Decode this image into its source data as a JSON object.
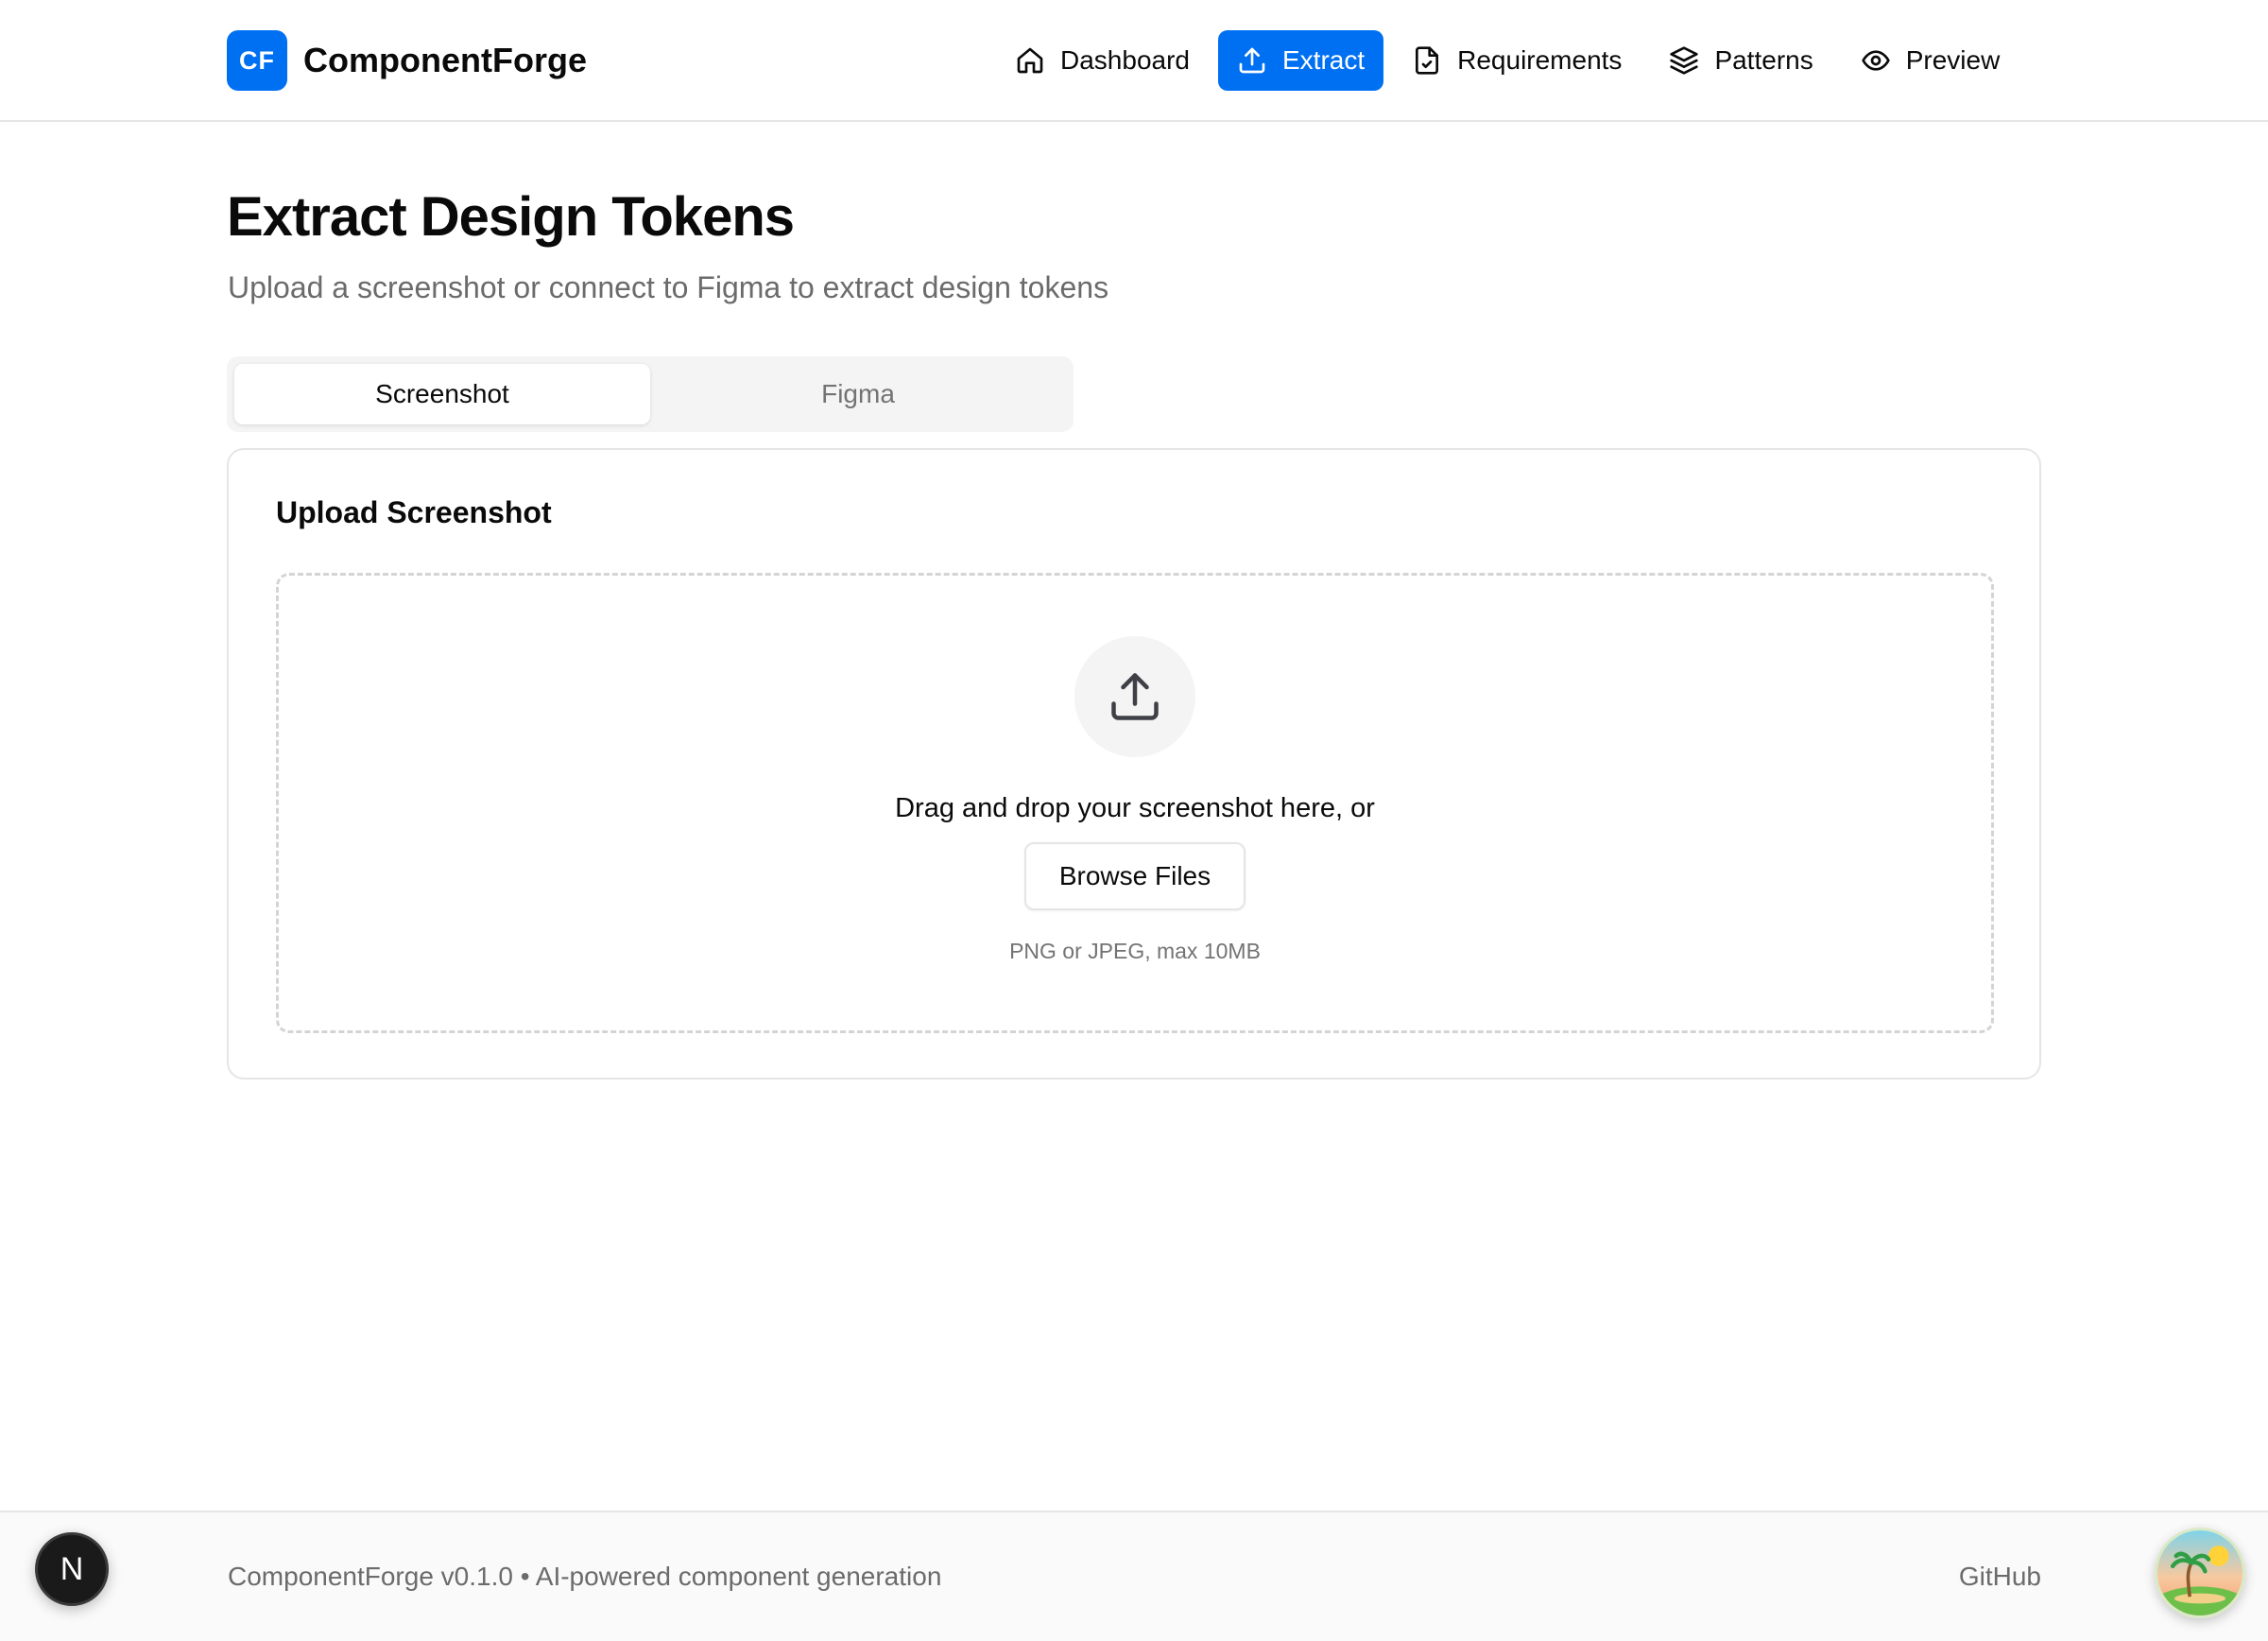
{
  "brand": {
    "logo_text": "CF",
    "name": "ComponentForge",
    "accent_color": "#0070f3"
  },
  "nav": {
    "items": [
      {
        "label": "Dashboard",
        "icon": "home-icon",
        "active": false
      },
      {
        "label": "Extract",
        "icon": "upload-icon",
        "active": true
      },
      {
        "label": "Requirements",
        "icon": "file-check-icon",
        "active": false
      },
      {
        "label": "Patterns",
        "icon": "layers-icon",
        "active": false
      },
      {
        "label": "Preview",
        "icon": "eye-icon",
        "active": false
      }
    ]
  },
  "page": {
    "title": "Extract Design Tokens",
    "subtitle": "Upload a screenshot or connect to Figma to extract design tokens"
  },
  "tabs": [
    {
      "label": "Screenshot",
      "active": true
    },
    {
      "label": "Figma",
      "active": false
    }
  ],
  "upload": {
    "card_title": "Upload Screenshot",
    "drop_text": "Drag and drop your screenshot here, or",
    "browse_label": "Browse Files",
    "hint": "PNG or JPEG, max 10MB"
  },
  "footer": {
    "text": "ComponentForge v0.1.0 • AI-powered component generation",
    "github_label": "GitHub"
  },
  "overlay": {
    "next_badge": "N"
  }
}
